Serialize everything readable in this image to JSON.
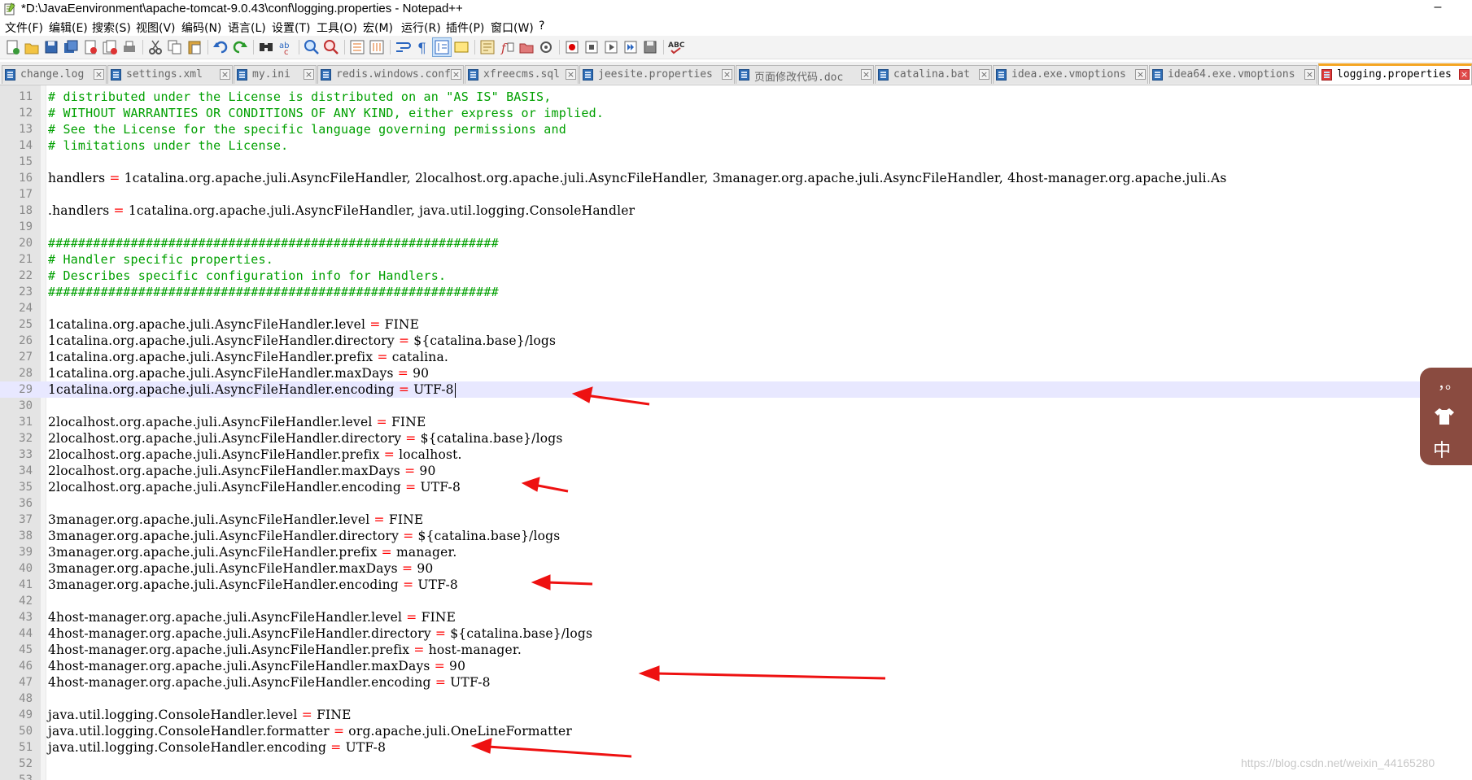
{
  "window": {
    "title": "*D:\\JavaEenvironment\\apache-tomcat-9.0.43\\conf\\logging.properties - Notepad++",
    "minimize": "–"
  },
  "menu": [
    "文件(F)",
    "编辑(E)",
    "搜索(S)",
    "视图(V)",
    "编码(N)",
    "语言(L)",
    "设置(T)",
    "工具(O)",
    "宏(M)",
    "运行(R)",
    "插件(P)",
    "窗口(W)",
    "?"
  ],
  "tabs": [
    {
      "label": "change.log",
      "active": false
    },
    {
      "label": "settings.xml",
      "active": false
    },
    {
      "label": "my.ini",
      "active": false
    },
    {
      "label": "redis.windows.conf",
      "active": false
    },
    {
      "label": "xfreecms.sql",
      "active": false
    },
    {
      "label": "jeesite.properties",
      "active": false
    },
    {
      "label": "页面修改代码.doc",
      "active": false
    },
    {
      "label": "catalina.bat",
      "active": false
    },
    {
      "label": "idea.exe.vmoptions",
      "active": false
    },
    {
      "label": "idea64.exe.vmoptions",
      "active": false
    },
    {
      "label": "logging.properties",
      "active": true
    }
  ],
  "tab_close": "×",
  "lines": [
    {
      "n": "11",
      "kind": "comment",
      "text": "# distributed under the License is distributed on an \"AS IS\" BASIS,"
    },
    {
      "n": "12",
      "kind": "comment",
      "text": "# WITHOUT WARRANTIES OR CONDITIONS OF ANY KIND, either express or implied."
    },
    {
      "n": "13",
      "kind": "comment",
      "text": "# See the License for the specific language governing permissions and"
    },
    {
      "n": "14",
      "kind": "comment",
      "text": "# limitations under the License."
    },
    {
      "n": "15",
      "kind": "blank"
    },
    {
      "n": "16",
      "kind": "kv",
      "key": "handlers",
      "value": "1catalina.org.apache.juli.AsyncFileHandler, 2localhost.org.apache.juli.AsyncFileHandler, 3manager.org.apache.juli.AsyncFileHandler, 4host-manager.org.apache.juli.As"
    },
    {
      "n": "17",
      "kind": "blank"
    },
    {
      "n": "18",
      "kind": "kv",
      "key": ".handlers",
      "value": "1catalina.org.apache.juli.AsyncFileHandler, java.util.logging.ConsoleHandler"
    },
    {
      "n": "19",
      "kind": "blank"
    },
    {
      "n": "20",
      "kind": "comment",
      "text": "############################################################"
    },
    {
      "n": "21",
      "kind": "comment",
      "text": "# Handler specific properties."
    },
    {
      "n": "22",
      "kind": "comment",
      "text": "# Describes specific configuration info for Handlers."
    },
    {
      "n": "23",
      "kind": "comment",
      "text": "############################################################"
    },
    {
      "n": "24",
      "kind": "blank"
    },
    {
      "n": "25",
      "kind": "kv",
      "key": "1catalina.org.apache.juli.AsyncFileHandler.level",
      "value": "FINE"
    },
    {
      "n": "26",
      "kind": "kv",
      "key": "1catalina.org.apache.juli.AsyncFileHandler.directory",
      "value": "${catalina.base}/logs"
    },
    {
      "n": "27",
      "kind": "kv",
      "key": "1catalina.org.apache.juli.AsyncFileHandler.prefix",
      "value": "catalina."
    },
    {
      "n": "28",
      "kind": "kv",
      "key": "1catalina.org.apache.juli.AsyncFileHandler.maxDays",
      "value": "90"
    },
    {
      "n": "29",
      "kind": "kv",
      "key": "1catalina.org.apache.juli.AsyncFileHandler.encoding",
      "value": "UTF-8",
      "current": true
    },
    {
      "n": "30",
      "kind": "blank"
    },
    {
      "n": "31",
      "kind": "kv",
      "key": "2localhost.org.apache.juli.AsyncFileHandler.level",
      "value": "FINE"
    },
    {
      "n": "32",
      "kind": "kv",
      "key": "2localhost.org.apache.juli.AsyncFileHandler.directory",
      "value": "${catalina.base}/logs"
    },
    {
      "n": "33",
      "kind": "kv",
      "key": "2localhost.org.apache.juli.AsyncFileHandler.prefix",
      "value": "localhost."
    },
    {
      "n": "34",
      "kind": "kv",
      "key": "2localhost.org.apache.juli.AsyncFileHandler.maxDays",
      "value": "90"
    },
    {
      "n": "35",
      "kind": "kv",
      "key": "2localhost.org.apache.juli.AsyncFileHandler.encoding",
      "value": "UTF-8"
    },
    {
      "n": "36",
      "kind": "blank"
    },
    {
      "n": "37",
      "kind": "kv",
      "key": "3manager.org.apache.juli.AsyncFileHandler.level",
      "value": "FINE"
    },
    {
      "n": "38",
      "kind": "kv",
      "key": "3manager.org.apache.juli.AsyncFileHandler.directory",
      "value": "${catalina.base}/logs"
    },
    {
      "n": "39",
      "kind": "kv",
      "key": "3manager.org.apache.juli.AsyncFileHandler.prefix",
      "value": "manager."
    },
    {
      "n": "40",
      "kind": "kv",
      "key": "3manager.org.apache.juli.AsyncFileHandler.maxDays",
      "value": "90"
    },
    {
      "n": "41",
      "kind": "kv",
      "key": "3manager.org.apache.juli.AsyncFileHandler.encoding",
      "value": "UTF-8"
    },
    {
      "n": "42",
      "kind": "blank"
    },
    {
      "n": "43",
      "kind": "kv",
      "key": "4host-manager.org.apache.juli.AsyncFileHandler.level",
      "value": "FINE"
    },
    {
      "n": "44",
      "kind": "kv",
      "key": "4host-manager.org.apache.juli.AsyncFileHandler.directory",
      "value": "${catalina.base}/logs"
    },
    {
      "n": "45",
      "kind": "kv",
      "key": "4host-manager.org.apache.juli.AsyncFileHandler.prefix",
      "value": "host-manager."
    },
    {
      "n": "46",
      "kind": "kv",
      "key": "4host-manager.org.apache.juli.AsyncFileHandler.maxDays",
      "value": "90"
    },
    {
      "n": "47",
      "kind": "kv",
      "key": "4host-manager.org.apache.juli.AsyncFileHandler.encoding",
      "value": "UTF-8"
    },
    {
      "n": "48",
      "kind": "blank"
    },
    {
      "n": "49",
      "kind": "kv",
      "key": "java.util.logging.ConsoleHandler.level",
      "value": "FINE"
    },
    {
      "n": "50",
      "kind": "kv",
      "key": "java.util.logging.ConsoleHandler.formatter",
      "value": "org.apache.juli.OneLineFormatter"
    },
    {
      "n": "51",
      "kind": "kv",
      "key": "java.util.logging.ConsoleHandler.encoding",
      "value": "UTF-8"
    },
    {
      "n": "52",
      "kind": "blank"
    },
    {
      "n": "53",
      "kind": "blank"
    }
  ],
  "operator": "=",
  "ime": {
    "punct": "，。",
    "lang": "中",
    "icon": "shirt-icon"
  },
  "watermark": "https://blog.csdn.net/weixin_44165280",
  "colors": {
    "comment": "#00a000",
    "operator": "#ff0000",
    "annotation_arrow": "#ee1111",
    "ime_bg": "#8a4b40",
    "active_tab_accent": "#f5a623"
  }
}
